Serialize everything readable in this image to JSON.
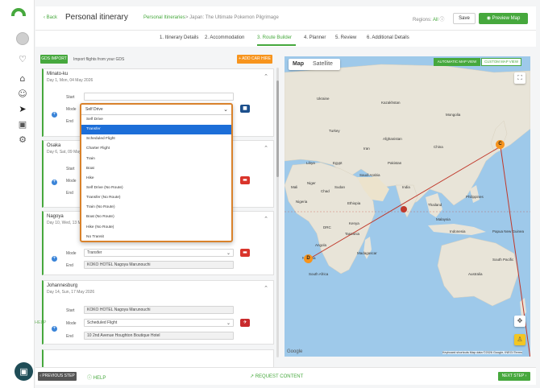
{
  "header": {
    "back_label": "Back",
    "title": "Personal itinerary",
    "breadcrumb_link": "Personal Itineraries",
    "breadcrumb_current": "Japan: The Ultimate Pokemon Pilgrimage",
    "regions_label": "Regions:",
    "regions_value": "All",
    "save_label": "Save",
    "preview_label": "Preview Map"
  },
  "tabs": [
    {
      "label": "1. Itinerary Details"
    },
    {
      "label": "2. Accommodation"
    },
    {
      "label": "3. Route Builder"
    },
    {
      "label": "4. Planner"
    },
    {
      "label": "5. Review"
    },
    {
      "label": "6. Additional Details"
    }
  ],
  "active_tab": "3. Route Builder",
  "toolbar": {
    "gds_label": "GDS IMPORT",
    "gds_text": "Import flights from your GDS",
    "car_hire_label": "+ ADD CAR HIRE"
  },
  "cards": [
    {
      "title": "Minato-ku",
      "subtitle": "Day 1, Mon, 04 May 2026",
      "start_label": "Start",
      "start_value": "",
      "mode_label": "Mode",
      "mode_value": "Self Drive",
      "end_label": "End"
    },
    {
      "title": "Osaka",
      "subtitle": "Day 6, Sat, 09 May 2026",
      "start_label": "Start",
      "mode_label": "Mode",
      "end_label": "End"
    },
    {
      "title": "Nagoya",
      "subtitle": "Day 10, Wed, 13 May 2026",
      "mode_label": "Mode",
      "mode_value": "Transfer",
      "end_label": "End",
      "end_value": "KOKO HOTEL Nagoya Marunouchi"
    },
    {
      "title": "Johannesburg",
      "subtitle": "Day 14, Sun, 17 May 2026",
      "start_label": "Start",
      "start_value": "KOKO HOTEL Nagoya Marunouchi",
      "mode_label": "Mode",
      "mode_value": "Scheduled Flight",
      "end_label": "End",
      "end_value": "10 2nd Avenue Houghton Boutique Hotel"
    }
  ],
  "dropdown": {
    "current": "Self Drive",
    "options": [
      "Self Drive",
      "Transfer",
      "Scheduled Flight",
      "Charter Flight",
      "Train",
      "Boat",
      "Hike",
      "Self Drive (No Route)",
      "Transfer (No Route)",
      "Train (No Route)",
      "Boat (No Route)",
      "Hike (No Route)",
      "No Transit"
    ],
    "highlighted": "Transfer"
  },
  "map": {
    "tab_map": "Map",
    "tab_satellite": "Satellite",
    "auto_view_label": "AUTOMATIC MAP VIEW",
    "custom_view_label": "CUSTOM MAP VIEW",
    "labels": [
      "Ukraine",
      "Kazakhstan",
      "Mongolia",
      "Turkey",
      "Iran",
      "Afghanistan",
      "China",
      "Libya",
      "Egypt",
      "Saudi Arabia",
      "Pakistan",
      "India",
      "Mali",
      "Niger",
      "Chad",
      "Sudan",
      "Ethiopia",
      "Nigeria",
      "Thailand",
      "Philippines",
      "Malaysia",
      "Indonesia",
      "Kenya",
      "Tanzania",
      "DRC",
      "Angola",
      "Madagascar",
      "Namibia",
      "South Africa",
      "Australia",
      "Papua New Guinea",
      "South Pacific"
    ],
    "footer": "Keyboard shortcuts   Map data ©2026 Google, INEGI   Terms",
    "google_logo": "Google",
    "markers": [
      "C",
      "D"
    ],
    "colors": {
      "route": "#c0392b",
      "water": "#9ec9ea",
      "land": "#e8e4d8"
    }
  },
  "footer": {
    "prev_label": "PREVIOUS STEP",
    "help_label": "HELP",
    "request_label": "REQUEST CONTENT",
    "next_label": "NEXT STEP"
  },
  "side_help": "HELP",
  "colors": {
    "accent": "#46a83d",
    "orange": "#f7941d",
    "dropdown_border": "#d9822b",
    "selected": "#1c6ed8",
    "danger": "#d9342b"
  }
}
